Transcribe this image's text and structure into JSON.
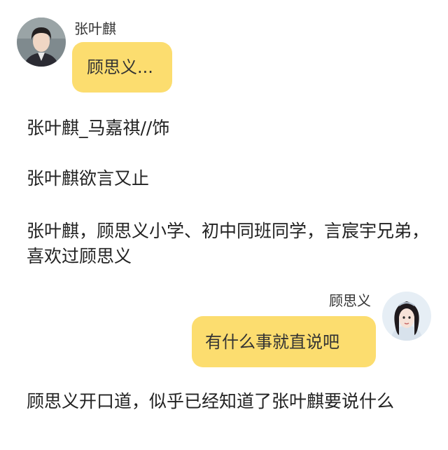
{
  "accent_color": "#FCDD6F",
  "messages": {
    "msg1": {
      "sender": "张叶麒",
      "text": "顾思义...",
      "avatar": "avatar-boy"
    },
    "msg2": {
      "sender": "顾思义",
      "text": "有什么事就直说吧",
      "avatar": "avatar-girl"
    }
  },
  "narration": {
    "line1": "张叶麒_马嘉祺//饰",
    "line2": "张叶麒欲言又止",
    "line3": "张叶麒，顾思义小学、初中同班同学，言宸宇兄弟，喜欢过顾思义",
    "line4": "顾思义开口道，似乎已经知道了张叶麒要说什么"
  }
}
